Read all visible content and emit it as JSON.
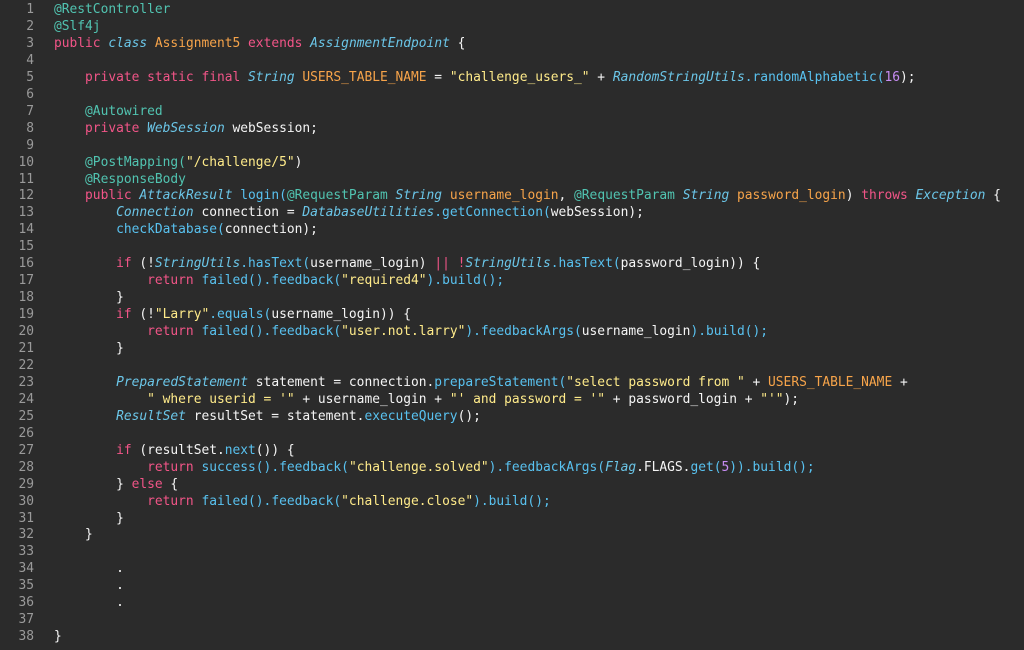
{
  "editor": {
    "lines": [
      {
        "no": "1",
        "tokens": [
          {
            "text": "@RestController",
            "type": "annotation"
          }
        ]
      },
      {
        "no": "2",
        "tokens": [
          {
            "text": "@Slf4j",
            "type": "annotation"
          }
        ]
      },
      {
        "no": "3",
        "tokens": [
          {
            "text": "public ",
            "type": "keyword"
          },
          {
            "text": "class ",
            "type": "italic"
          },
          {
            "text": "Assignment5",
            "type": "class"
          },
          {
            "text": " extends ",
            "type": "keyword"
          },
          {
            "text": "AssignmentEndpoint",
            "type": "italic"
          },
          {
            "text": " {",
            "type": "plain"
          }
        ]
      },
      {
        "no": "4",
        "tokens": []
      },
      {
        "no": "5",
        "tokens": [
          {
            "text": "    private static final ",
            "type": "keyword"
          },
          {
            "text": "String",
            "type": "italic"
          },
          {
            "text": " USERS_TABLE_NAME",
            "type": "class"
          },
          {
            "text": " = ",
            "type": "plain"
          },
          {
            "text": "\"challenge_users_\"",
            "type": "string"
          },
          {
            "text": " + ",
            "type": "plain"
          },
          {
            "text": "RandomStringUtils",
            "type": "italic"
          },
          {
            "text": ".randomAlphabetic(",
            "type": "method"
          },
          {
            "text": "16",
            "type": "number"
          },
          {
            "text": ");",
            "type": "plain"
          }
        ]
      },
      {
        "no": "6",
        "tokens": []
      },
      {
        "no": "7",
        "tokens": [
          {
            "text": "    @Autowired",
            "type": "annotation"
          }
        ]
      },
      {
        "no": "8",
        "tokens": [
          {
            "text": "    private ",
            "type": "keyword"
          },
          {
            "text": "WebSession",
            "type": "italic"
          },
          {
            "text": " webSession;",
            "type": "plain"
          }
        ]
      },
      {
        "no": "9",
        "tokens": []
      },
      {
        "no": "10",
        "tokens": [
          {
            "text": "    @PostMapping(",
            "type": "annotation"
          },
          {
            "text": "\"/challenge/5\"",
            "type": "string"
          },
          {
            "text": ")",
            "type": "plain"
          }
        ]
      },
      {
        "no": "11",
        "tokens": [
          {
            "text": "    @ResponseBody",
            "type": "annotation"
          }
        ]
      },
      {
        "no": "12",
        "tokens": [
          {
            "text": "    public ",
            "type": "keyword"
          },
          {
            "text": "AttackResult",
            "type": "italic"
          },
          {
            "text": " login(",
            "type": "method"
          },
          {
            "text": "@RequestParam ",
            "type": "annotation"
          },
          {
            "text": "String",
            "type": "italic"
          },
          {
            "text": " username_login",
            "type": "class"
          },
          {
            "text": ", ",
            "type": "plain"
          },
          {
            "text": "@RequestParam ",
            "type": "annotation"
          },
          {
            "text": "String",
            "type": "italic"
          },
          {
            "text": " password_login",
            "type": "class"
          },
          {
            "text": ") ",
            "type": "plain"
          },
          {
            "text": "throws ",
            "type": "keyword"
          },
          {
            "text": "Exception",
            "type": "italic"
          },
          {
            "text": " {",
            "type": "plain"
          }
        ]
      },
      {
        "no": "13",
        "tokens": [
          {
            "text": "        Connection",
            "type": "italic"
          },
          {
            "text": " connection = ",
            "type": "plain"
          },
          {
            "text": "DatabaseUtilities",
            "type": "italic"
          },
          {
            "text": ".getConnection(",
            "type": "method"
          },
          {
            "text": "webSession);",
            "type": "plain"
          }
        ]
      },
      {
        "no": "14",
        "tokens": [
          {
            "text": "        checkDatabase(",
            "type": "method"
          },
          {
            "text": "connection);",
            "type": "plain"
          }
        ]
      },
      {
        "no": "15",
        "tokens": []
      },
      {
        "no": "16",
        "tokens": [
          {
            "text": "        if ",
            "type": "keyword"
          },
          {
            "text": "(!",
            "type": "plain"
          },
          {
            "text": "StringUtils",
            "type": "italic"
          },
          {
            "text": ".hasText(",
            "type": "method"
          },
          {
            "text": "username_login) ",
            "type": "plain"
          },
          {
            "text": "|| !",
            "type": "keyword"
          },
          {
            "text": "StringUtils",
            "type": "italic"
          },
          {
            "text": ".hasText(",
            "type": "method"
          },
          {
            "text": "password_login)) {",
            "type": "plain"
          }
        ]
      },
      {
        "no": "17",
        "tokens": [
          {
            "text": "            return ",
            "type": "keyword"
          },
          {
            "text": "failed().feedback(",
            "type": "method"
          },
          {
            "text": "\"required4\"",
            "type": "string"
          },
          {
            "text": ").build();",
            "type": "method"
          }
        ]
      },
      {
        "no": "18",
        "tokens": [
          {
            "text": "        }",
            "type": "plain"
          }
        ]
      },
      {
        "no": "19",
        "tokens": [
          {
            "text": "        if ",
            "type": "keyword"
          },
          {
            "text": "(!",
            "type": "plain"
          },
          {
            "text": "\"Larry\"",
            "type": "string"
          },
          {
            "text": ".equals(",
            "type": "method"
          },
          {
            "text": "username_login)) {",
            "type": "plain"
          }
        ]
      },
      {
        "no": "20",
        "tokens": [
          {
            "text": "            return ",
            "type": "keyword"
          },
          {
            "text": "failed().feedback(",
            "type": "method"
          },
          {
            "text": "\"user.not.larry\"",
            "type": "string"
          },
          {
            "text": ").feedbackArgs(",
            "type": "method"
          },
          {
            "text": "username_login",
            "type": "plain"
          },
          {
            "text": ").build();",
            "type": "method"
          }
        ]
      },
      {
        "no": "21",
        "tokens": [
          {
            "text": "        }",
            "type": "plain"
          }
        ]
      },
      {
        "no": "22",
        "tokens": []
      },
      {
        "no": "23",
        "tokens": [
          {
            "text": "        PreparedStatement",
            "type": "italic"
          },
          {
            "text": " statement = connection.",
            "type": "plain"
          },
          {
            "text": "prepareStatement(",
            "type": "method"
          },
          {
            "text": "\"select password from \"",
            "type": "string"
          },
          {
            "text": " + ",
            "type": "plain"
          },
          {
            "text": "USERS_TABLE_NAME",
            "type": "class"
          },
          {
            "text": " +",
            "type": "plain"
          }
        ]
      },
      {
        "no": "24",
        "tokens": [
          {
            "text": "            \" where userid = '\"",
            "type": "string"
          },
          {
            "text": " + username_login + ",
            "type": "plain"
          },
          {
            "text": "\"' and password = '\"",
            "type": "string"
          },
          {
            "text": " + password_login + ",
            "type": "plain"
          },
          {
            "text": "\"'\"",
            "type": "string"
          },
          {
            "text": ");",
            "type": "plain"
          }
        ]
      },
      {
        "no": "25",
        "tokens": [
          {
            "text": "        ResultSet",
            "type": "italic"
          },
          {
            "text": " resultSet = statement.",
            "type": "plain"
          },
          {
            "text": "executeQuery",
            "type": "method"
          },
          {
            "text": "();",
            "type": "plain"
          }
        ]
      },
      {
        "no": "26",
        "tokens": []
      },
      {
        "no": "27",
        "tokens": [
          {
            "text": "        if ",
            "type": "keyword"
          },
          {
            "text": "(resultSet.",
            "type": "plain"
          },
          {
            "text": "next",
            "type": "method"
          },
          {
            "text": "()) {",
            "type": "plain"
          }
        ]
      },
      {
        "no": "28",
        "tokens": [
          {
            "text": "            return ",
            "type": "keyword"
          },
          {
            "text": "success().feedback(",
            "type": "method"
          },
          {
            "text": "\"challenge.solved\"",
            "type": "string"
          },
          {
            "text": ").feedbackArgs(",
            "type": "method"
          },
          {
            "text": "Flag",
            "type": "italic"
          },
          {
            "text": ".FLAGS.",
            "type": "plain"
          },
          {
            "text": "get(",
            "type": "method"
          },
          {
            "text": "5",
            "type": "number"
          },
          {
            "text": ")).build();",
            "type": "method"
          }
        ]
      },
      {
        "no": "29",
        "tokens": [
          {
            "text": "        } ",
            "type": "plain"
          },
          {
            "text": "else ",
            "type": "keyword"
          },
          {
            "text": "{",
            "type": "plain"
          }
        ]
      },
      {
        "no": "30",
        "tokens": [
          {
            "text": "            return ",
            "type": "keyword"
          },
          {
            "text": "failed().feedback(",
            "type": "method"
          },
          {
            "text": "\"challenge.close\"",
            "type": "string"
          },
          {
            "text": ").build();",
            "type": "method"
          }
        ]
      },
      {
        "no": "31",
        "tokens": [
          {
            "text": "        }",
            "type": "plain"
          }
        ]
      },
      {
        "no": "32",
        "tokens": [
          {
            "text": "    }",
            "type": "plain"
          }
        ]
      },
      {
        "no": "33",
        "tokens": []
      },
      {
        "no": "34",
        "tokens": [
          {
            "text": "        .",
            "type": "dots"
          }
        ]
      },
      {
        "no": "35",
        "tokens": [
          {
            "text": "        .",
            "type": "dots"
          }
        ]
      },
      {
        "no": "36",
        "tokens": [
          {
            "text": "        .",
            "type": "dots"
          }
        ]
      },
      {
        "no": "37",
        "tokens": []
      },
      {
        "no": "38",
        "tokens": [
          {
            "text": "}",
            "type": "plain"
          }
        ]
      }
    ]
  },
  "theme": {
    "background": "#2b2b2b",
    "line_number": "#9a9a9a",
    "annotation": "#51c4b1",
    "keyword": "#f25588",
    "italic_type": "#6bc6e8",
    "class_or_field": "#f7a44a",
    "string": "#ffeb8a",
    "number": "#c88df4",
    "method": "#59c2f0",
    "plain": "#f5f5f5"
  }
}
